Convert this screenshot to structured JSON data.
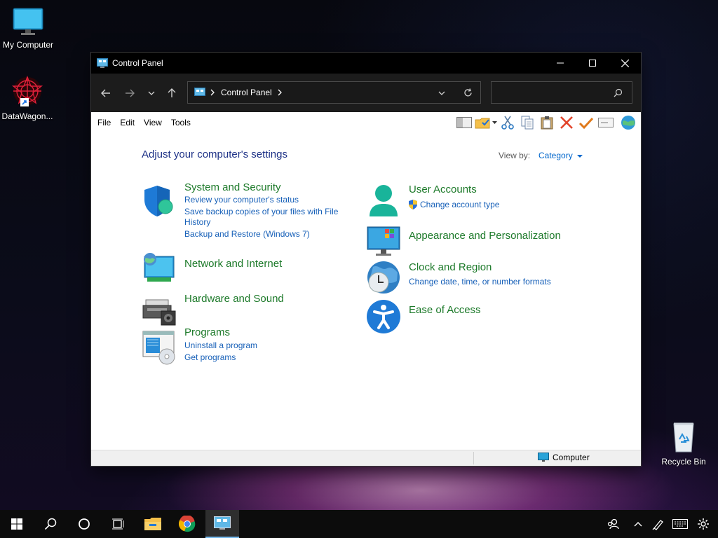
{
  "desktop": {
    "icons": [
      {
        "label": "My Computer"
      },
      {
        "label": "DataWagon..."
      },
      {
        "label": "Recycle Bin"
      }
    ]
  },
  "window": {
    "title": "Control Panel",
    "address": {
      "segment": "Control Panel"
    },
    "search": {
      "placeholder": ""
    },
    "menu": [
      "File",
      "Edit",
      "View",
      "Tools"
    ],
    "heading": "Adjust your computer's settings",
    "view_by": {
      "label": "View by:",
      "value": "Category"
    },
    "categories": {
      "system": {
        "title": "System and Security",
        "links": [
          "Review your computer's status",
          "Save backup copies of your files with File",
          "History",
          "Backup and Restore (Windows 7)"
        ]
      },
      "network": {
        "title": "Network and Internet"
      },
      "hardware": {
        "title": "Hardware and Sound"
      },
      "programs": {
        "title": "Programs",
        "links": [
          "Uninstall a program",
          "Get programs"
        ]
      },
      "users": {
        "title": "User Accounts",
        "links": [
          "Change account type"
        ]
      },
      "appearance": {
        "title": "Appearance and Personalization"
      },
      "clock": {
        "title": "Clock and Region",
        "links": [
          "Change date, time, or number formats"
        ]
      },
      "ease": {
        "title": "Ease of Access"
      }
    },
    "status": {
      "location": "Computer"
    }
  },
  "colors": {
    "category_title": "#1d7a2a",
    "link": "#1760b8",
    "heading": "#1e3287",
    "taskbar_accent": "#76b9ed"
  }
}
